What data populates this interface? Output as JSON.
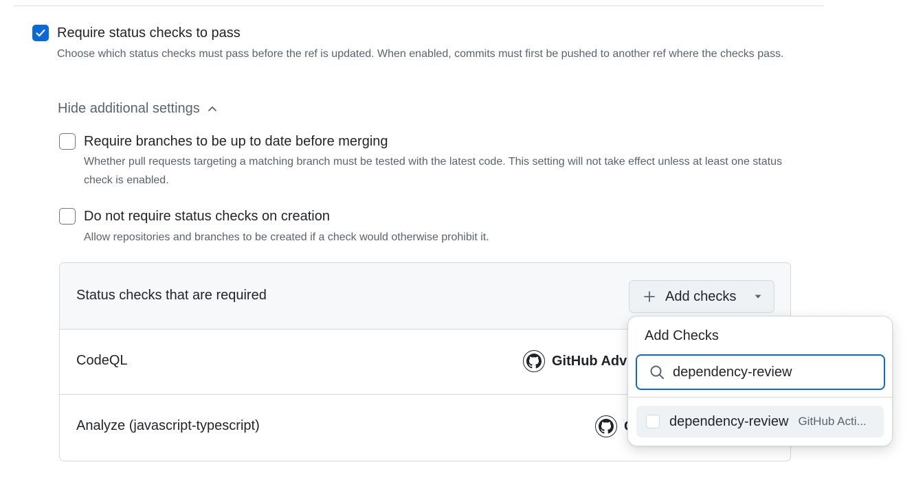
{
  "require_status_checks": {
    "checked": true,
    "title": "Require status checks to pass",
    "description": "Choose which status checks must pass before the ref is updated. When enabled, commits must first be pushed to another ref where the checks pass."
  },
  "toggle_label": "Hide additional settings",
  "options": [
    {
      "checked": false,
      "title": "Require branches to be up to date before merging",
      "description": "Whether pull requests targeting a matching branch must be tested with the latest code. This setting will not take effect unless at least one status check is enabled."
    },
    {
      "checked": false,
      "title": "Do not require status checks on creation",
      "description": "Allow repositories and branches to be created if a check would otherwise prohibit it."
    }
  ],
  "checks_box": {
    "title": "Status checks that are required",
    "add_button_label": "Add checks",
    "rows": [
      {
        "name": "CodeQL",
        "source": "GitHub Adv"
      },
      {
        "name": "Analyze (javascript-typescript)",
        "source": "G"
      }
    ]
  },
  "dropdown": {
    "title": "Add Checks",
    "search_value": "dependency-review",
    "results": [
      {
        "name": "dependency-review",
        "source": "GitHub Acti..."
      }
    ]
  },
  "colors": {
    "accent": "#0969da",
    "text": "#1f2328",
    "muted": "#59636e",
    "border": "#d1d9e0",
    "header_bg": "#f6f8fa"
  }
}
